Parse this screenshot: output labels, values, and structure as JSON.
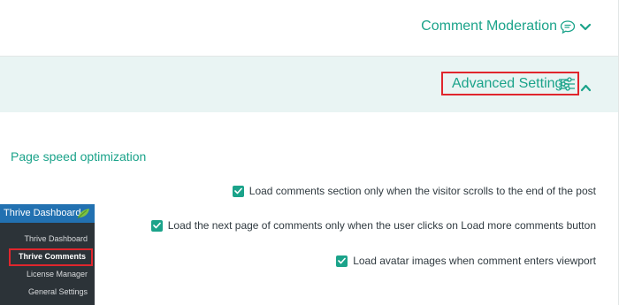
{
  "comment_moderation": {
    "label": "Comment Moderation",
    "icon": "chat-bubble-icon",
    "toggle_icon": "chevron-down-icon"
  },
  "advanced_settings": {
    "label": "Advanced Settings",
    "icon": "sliders-icon",
    "toggle_icon": "chevron-up-icon",
    "expanded": true
  },
  "page_speed": {
    "heading": "Page speed optimization",
    "options": [
      {
        "label": "Load comments section only when the visitor scrolls to the end of the post",
        "checked": true
      },
      {
        "label": "Load the next page of comments only when the user clicks on Load more comments button",
        "checked": true
      },
      {
        "label": "Load avatar images when comment enters viewport",
        "checked": true
      }
    ]
  },
  "wp_menu": {
    "header": "Thrive Dashboard",
    "header_icon": "leaf-icon",
    "items": [
      {
        "label": "Thrive Dashboard",
        "current": false
      },
      {
        "label": "Thrive Comments",
        "current": true
      },
      {
        "label": "License Manager",
        "current": false
      },
      {
        "label": "General Settings",
        "current": false
      }
    ]
  },
  "colors": {
    "accent": "#1ba38a",
    "panel_bg": "#e9f4f3",
    "highlight": "#e0262d",
    "wp_menu_bg": "#2c3338",
    "wp_menu_head": "#2271b1"
  }
}
